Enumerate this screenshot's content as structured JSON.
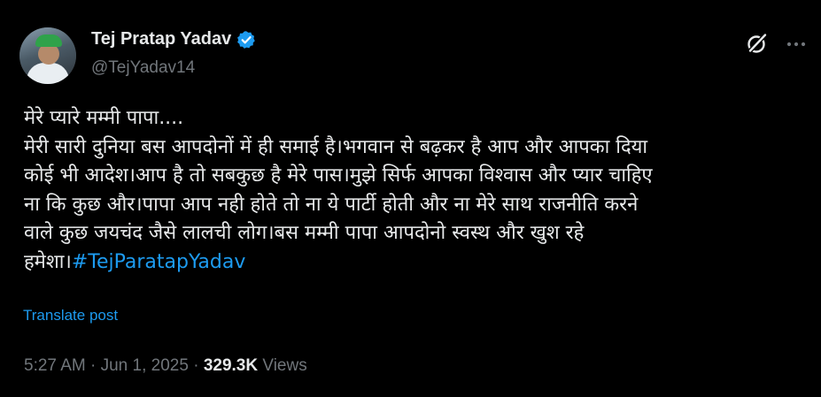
{
  "author": {
    "display_name": "Tej Pratap Yadav",
    "handle": "@TejYadav14",
    "verified": true
  },
  "post": {
    "lines": [
      "मेरे प्यारे मम्मी पापा....",
      "मेरी सारी दुनिया बस आपदोनों में ही समाई है।भगवान से बढ़कर है आप और आपका दिया",
      "कोई भी आदेश।आप है तो सबकुछ है मेरे पास।मुझे सिर्फ आपका विश्वास और प्यार चाहिए",
      "ना कि कुछ और।पापा आप नही होते तो ना ये पार्टी होती और ना मेरे साथ राजनीति करने",
      "वाले कुछ जयचंद जैसे लालची लोग।बस मम्मी पापा आपदोनो स्वस्थ और खुश रहे"
    ],
    "last_line_prefix": "हमेशा।",
    "hashtag": "#TejParatapYadav",
    "translate_label": "Translate post"
  },
  "meta": {
    "time": "5:27 AM",
    "separator": "·",
    "date": "Jun 1, 2025",
    "views_count": "329.3K",
    "views_label": "Views"
  },
  "icons": {
    "verified": "verified-badge-icon",
    "grok": "grok-icon",
    "more": "more-options-icon"
  },
  "colors": {
    "background": "#000000",
    "text": "#e7e9ea",
    "muted": "#71767b",
    "accent": "#1d9bf0"
  }
}
